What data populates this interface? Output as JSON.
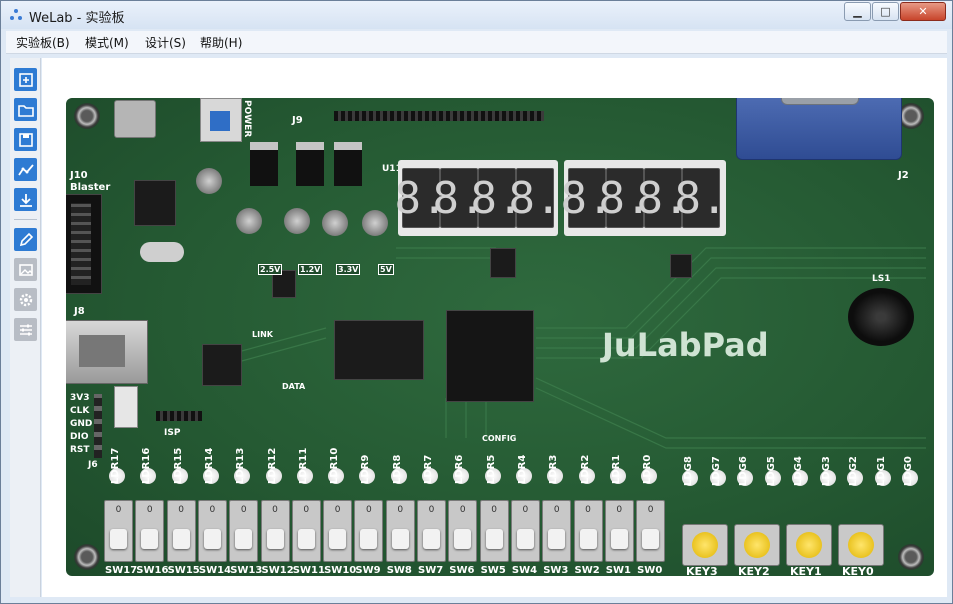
{
  "window": {
    "title": "WeLab - 实验板",
    "min_symbol": "▁",
    "max_symbol": "□",
    "close_symbol": "✕"
  },
  "menu": [
    "实验板(B)",
    "模式(M)",
    "设计(S)",
    "帮助(H)"
  ],
  "toolbar": {
    "tools": [
      {
        "name": "new-icon",
        "glyph": "+"
      },
      {
        "name": "open-folder-icon",
        "glyph": "▭"
      },
      {
        "name": "save-icon",
        "glyph": "▣"
      },
      {
        "name": "waveform-icon",
        "glyph": "∿"
      },
      {
        "name": "download-icon",
        "glyph": "⤓"
      },
      {
        "name": "pencil-icon",
        "glyph": "✎"
      },
      {
        "name": "image-icon",
        "glyph": "▨"
      },
      {
        "name": "gear-icon",
        "glyph": "⚙"
      },
      {
        "name": "sliders-icon",
        "glyph": "☰"
      }
    ]
  },
  "board": {
    "brand": "JuLabPad",
    "labels": {
      "power": "POWER",
      "blaster": "Blaster",
      "j10": "J10",
      "j8": "J8",
      "j9": "J9",
      "j2": "J2",
      "j6": "J6",
      "isp": "ISP",
      "config": "CONFIG",
      "u11": "U11",
      "ls1": "LS1",
      "link": "LINK",
      "data": "DATA"
    },
    "jtag_pins": [
      "3V3",
      "CLK",
      "GND",
      "DIO",
      "RST"
    ],
    "seven_segment": [
      "8.",
      "8.",
      "8.",
      "8.",
      "8.",
      "8.",
      "8.",
      "8."
    ],
    "voltages": [
      "2.5V",
      "1.2V",
      "3.3V",
      "5V"
    ],
    "ldr": [
      "LDR17",
      "LDR16",
      "LDR15",
      "LDR14",
      "LDR13",
      "LDR12",
      "LDR11",
      "LDR10",
      "LDR9",
      "LDR8",
      "LDR7",
      "LDR6",
      "LDR5",
      "LDR4",
      "LDR3",
      "LDR2",
      "LDR1",
      "LDR0"
    ],
    "ldg": [
      "LDG8",
      "LDG7",
      "LDG6",
      "LDG5",
      "LDG4",
      "LDG3",
      "LDG2",
      "LDG1",
      "LDG0"
    ],
    "switches": [
      "SW17",
      "SW16",
      "SW15",
      "SW14",
      "SW13",
      "SW12",
      "SW11",
      "SW10",
      "SW9",
      "SW8",
      "SW7",
      "SW6",
      "SW5",
      "SW4",
      "SW3",
      "SW2",
      "SW1",
      "SW0"
    ],
    "switch_state": "0",
    "keys": [
      "KEY3",
      "KEY2",
      "KEY1",
      "KEY0"
    ]
  },
  "colors": {
    "board_green": "#255a33",
    "toolbar_blue": "#2e7bd3",
    "vga_blue": "#3d5ea8",
    "key_yellow": "#f2c200"
  }
}
